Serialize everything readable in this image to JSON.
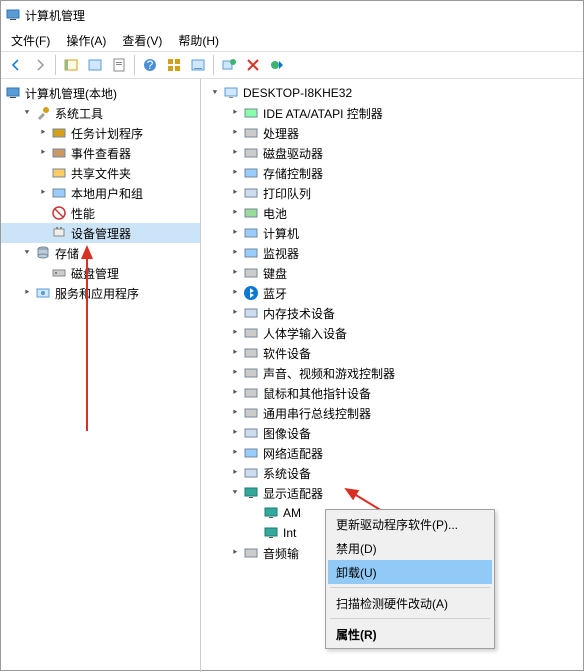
{
  "title": "计算机管理",
  "menu": [
    "文件(F)",
    "操作(A)",
    "查看(V)",
    "帮助(H)"
  ],
  "leftTree": {
    "root": "计算机管理(本地)",
    "groups": [
      {
        "label": "系统工具",
        "expanded": true,
        "children": [
          {
            "label": "任务计划程序",
            "icon": "clock"
          },
          {
            "label": "事件查看器",
            "icon": "event"
          },
          {
            "label": "共享文件夹",
            "icon": "folder"
          },
          {
            "label": "本地用户和组",
            "icon": "users"
          },
          {
            "label": "性能",
            "icon": "perf"
          },
          {
            "label": "设备管理器",
            "icon": "device",
            "selected": true
          }
        ]
      },
      {
        "label": "存储",
        "expanded": true,
        "children": [
          {
            "label": "磁盘管理",
            "icon": "disk"
          }
        ]
      },
      {
        "label": "服务和应用程序",
        "expanded": false,
        "icon": "services"
      }
    ]
  },
  "rightTree": {
    "root": "DESKTOP-I8KHE32",
    "children": [
      {
        "label": "IDE ATA/ATAPI 控制器",
        "icon": "ide"
      },
      {
        "label": "处理器",
        "icon": "cpu"
      },
      {
        "label": "磁盘驱动器",
        "icon": "disk"
      },
      {
        "label": "存储控制器",
        "icon": "storage"
      },
      {
        "label": "打印队列",
        "icon": "printer"
      },
      {
        "label": "电池",
        "icon": "battery"
      },
      {
        "label": "计算机",
        "icon": "computer"
      },
      {
        "label": "监视器",
        "icon": "monitor"
      },
      {
        "label": "键盘",
        "icon": "keyboard"
      },
      {
        "label": "蓝牙",
        "icon": "bluetooth"
      },
      {
        "label": "内存技术设备",
        "icon": "memory"
      },
      {
        "label": "人体学输入设备",
        "icon": "hid"
      },
      {
        "label": "软件设备",
        "icon": "software"
      },
      {
        "label": "声音、视频和游戏控制器",
        "icon": "sound"
      },
      {
        "label": "鼠标和其他指针设备",
        "icon": "mouse"
      },
      {
        "label": "通用串行总线控制器",
        "icon": "usb"
      },
      {
        "label": "图像设备",
        "icon": "image"
      },
      {
        "label": "网络适配器",
        "icon": "network"
      },
      {
        "label": "系统设备",
        "icon": "system"
      },
      {
        "label": "显示适配器",
        "icon": "display",
        "expanded": true,
        "children": [
          {
            "label": "AM",
            "truncated": true,
            "icon": "display"
          },
          {
            "label": "Int",
            "truncated": true,
            "icon": "display"
          }
        ]
      },
      {
        "label": "音频输",
        "truncated": true,
        "icon": "audio"
      }
    ]
  },
  "contextMenu": {
    "items": [
      {
        "label": "更新驱动程序软件(P)..."
      },
      {
        "label": "禁用(D)"
      },
      {
        "label": "卸载(U)",
        "highlight": true
      },
      {
        "sep": true
      },
      {
        "label": "扫描检测硬件改动(A)"
      },
      {
        "sep": true
      },
      {
        "label": "属性(R)",
        "bold": true
      }
    ]
  },
  "toolbarIcons": [
    "back",
    "forward",
    "up",
    "folder",
    "list",
    "props",
    "sep",
    "help",
    "tiles",
    "monitor",
    "sep",
    "scan",
    "delete",
    "complete"
  ]
}
